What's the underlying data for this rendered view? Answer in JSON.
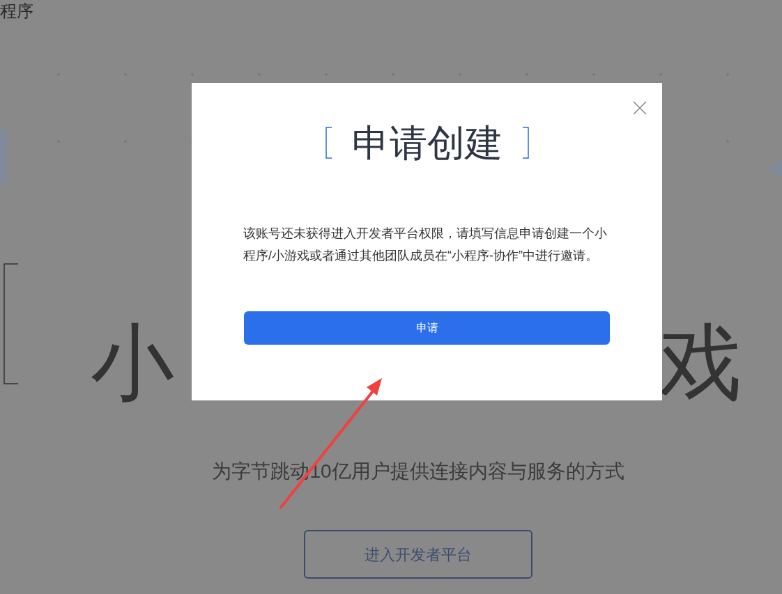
{
  "page": {
    "header_fragment": "程序",
    "hero_glyphs": [
      "小",
      "戏"
    ],
    "tagline": "为字节跳动10亿用户提供连接内容与服务的方式",
    "enter_button": "进入开发者平台"
  },
  "dialog": {
    "title": "申请创建",
    "message": "该账号还未获得进入开发者平台权限，请填写信息申请创建一个小程序/小游戏或者通过其他团队成员在“小程序-协作”中进行邀请。",
    "apply_button": "申请"
  }
}
